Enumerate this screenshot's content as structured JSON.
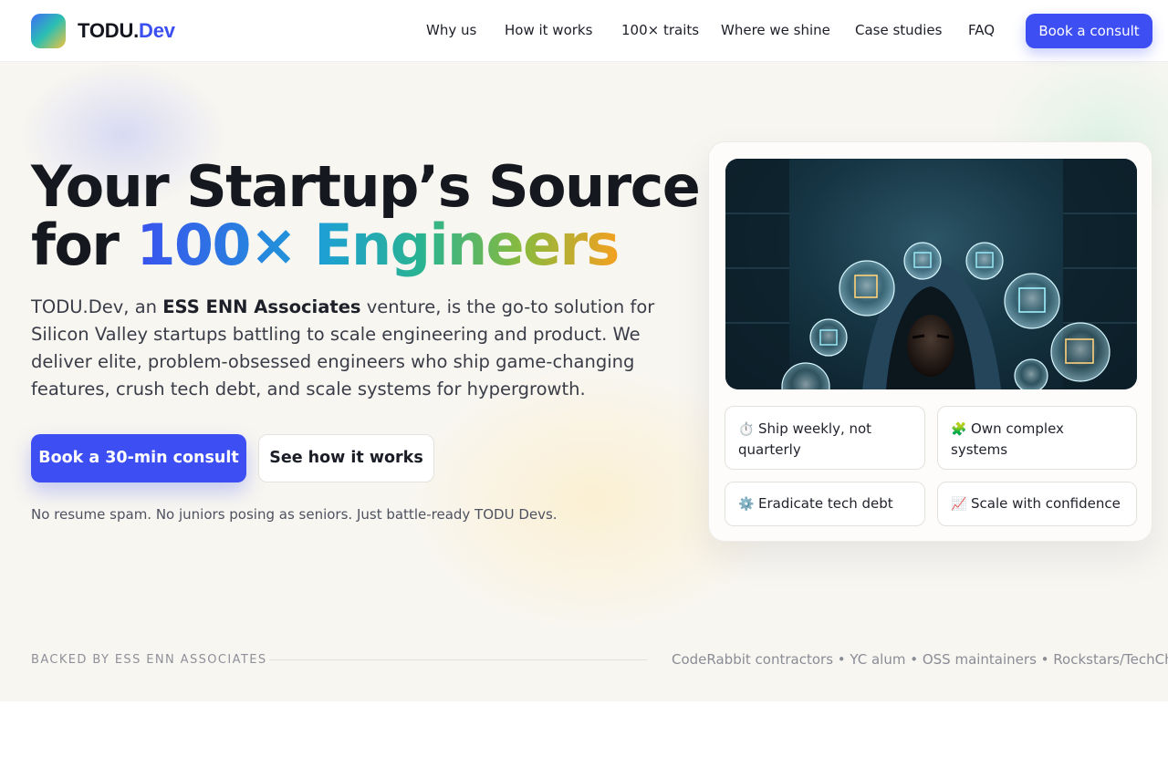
{
  "brand": {
    "name_main": "TODU.",
    "name_accent": "Dev"
  },
  "nav": {
    "links": [
      "Why us",
      "How it works",
      "100× traits",
      "Where we shine",
      "Case studies",
      "FAQ"
    ],
    "cta": "Book a consult"
  },
  "hero": {
    "headline_line1": "Your Startup’s Source",
    "headline_line2_prefix": "for ",
    "headline_line2_highlight": "100× Engineers",
    "lede_before": "TODU.Dev, an ",
    "lede_bold": "ESS ENN Associates",
    "lede_after": " venture, is the go-to solution for Silicon Valley startups battling to scale engineering and product. We deliver elite, problem-obsessed engineers who ship game-changing features, crush tech debt, and scale systems for hypergrowth.",
    "primary_cta": "Book a 30-min consult",
    "secondary_cta": "See how it works",
    "fine_print": "No resume spam. No juniors posing as seniors. Just battle-ready TODU Devs."
  },
  "card": {
    "traits": [
      {
        "icon": "⏱️",
        "icon_name": "stopwatch-icon",
        "label": "Ship weekly, not quarterly"
      },
      {
        "icon": "🧩",
        "icon_name": "puzzle-icon",
        "label": "Own complex systems"
      },
      {
        "icon": "⚙️",
        "icon_name": "gear-icon",
        "label": "Eradicate tech debt"
      },
      {
        "icon": "📈",
        "icon_name": "chart-up-icon",
        "label": "Scale with confidence"
      }
    ]
  },
  "backed": {
    "label": "BACKED BY ESS ENN ASSOCIATES",
    "proof": "CodeRabbit contractors • YC alum • OSS maintainers • Rockstars/TechChads"
  },
  "colors": {
    "accent": "#3d4ef2",
    "hero_bg": "#f8f6f1"
  }
}
